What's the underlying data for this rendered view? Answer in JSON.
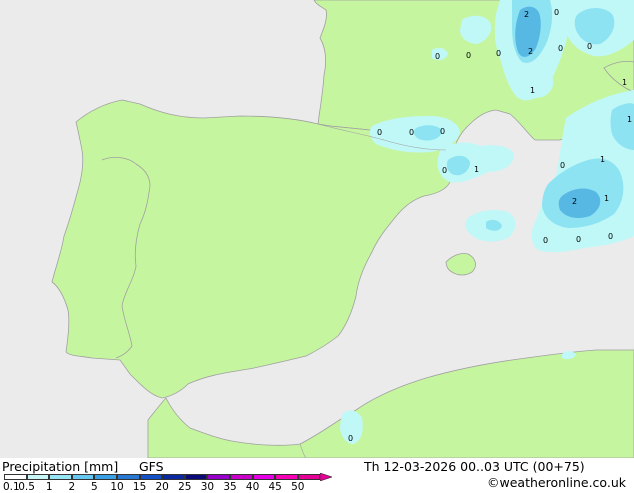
{
  "footer": {
    "title": "Precipitation [mm]",
    "model": "GFS",
    "datetime": "Th 12-03-2026 00..03 UTC (00+75)",
    "credit": "©weatheronline.co.uk"
  },
  "colors": {
    "sea": "#ebebeb",
    "land": "#c6f5a0",
    "precip_light": "#c0f8f8",
    "precip_mid": "#8de3f2",
    "precip_heavy": "#57b8e4"
  },
  "legend": {
    "colors": [
      "#ffffff",
      "#c8f5f5",
      "#96e6f5",
      "#64c8f0",
      "#3ca0e6",
      "#2878d2",
      "#1450c8",
      "#0a28a0",
      "#0a0a78",
      "#9600c8",
      "#c800c8",
      "#e600e6",
      "#f500b4",
      "#e60096"
    ],
    "labels": [
      "0.1",
      "0.5",
      "1",
      "2",
      "5",
      "10",
      "15",
      "20",
      "25",
      "30",
      "35",
      "40",
      "45",
      "50"
    ]
  },
  "map_labels": [
    "2",
    "0",
    "0",
    "0",
    "0",
    "2",
    "0",
    "0",
    "1",
    "1",
    "0",
    "0",
    "0",
    "0",
    "0",
    "1",
    "1",
    "2",
    "1",
    "0",
    "0",
    "0",
    "0",
    "1"
  ]
}
